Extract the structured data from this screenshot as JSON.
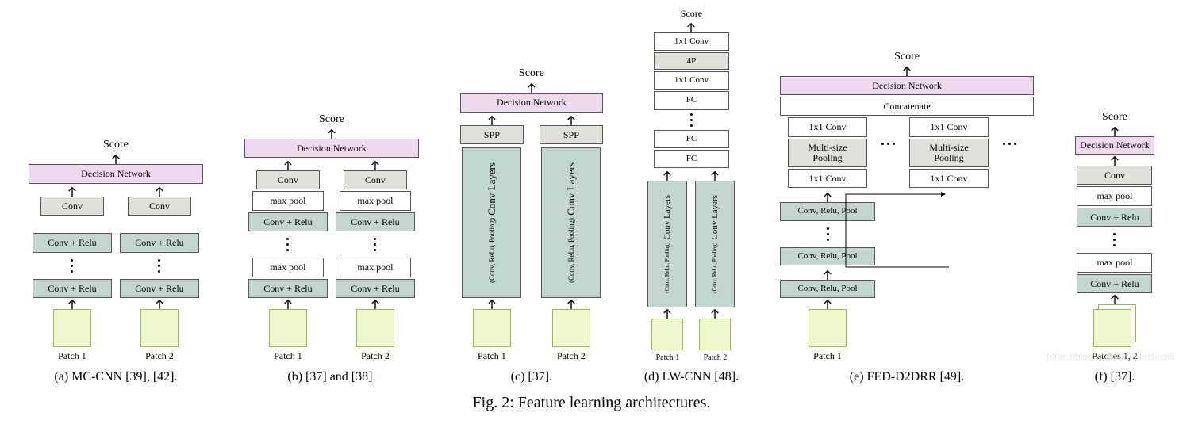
{
  "shared": {
    "score": "Score",
    "decision": "Decision Network",
    "conv": "Conv",
    "conv_relu": "Conv + Relu",
    "max_pool": "max pool",
    "spp": "SPP",
    "patch1": "Patch 1",
    "patch2": "Patch 2",
    "patches12": "Patches 1, 2",
    "conv_layers": "Conv Layers",
    "conv_layers_sub": "(Conv, ReLu, Pooling)",
    "conv1x1": "1x1 Conv",
    "fourP": "4P",
    "fc": "FC",
    "multi_size_pooling": "Multi-size Pooling",
    "concat": "Concatenate",
    "conv_relu_pool": "Conv, Relu, Pool"
  },
  "subtitles": {
    "a": "(a) MC-CNN [39], [42].",
    "b": "(b) [37] and [38].",
    "c": "(c) [37].",
    "d": "(d) LW-CNN [48].",
    "e": "(e) FED-D2DRR [49].",
    "f": "(f) [37]."
  },
  "caption": "Fig. 2: Feature learning architectures.",
  "watermark": "https://blog.csdn.net/electech6"
}
